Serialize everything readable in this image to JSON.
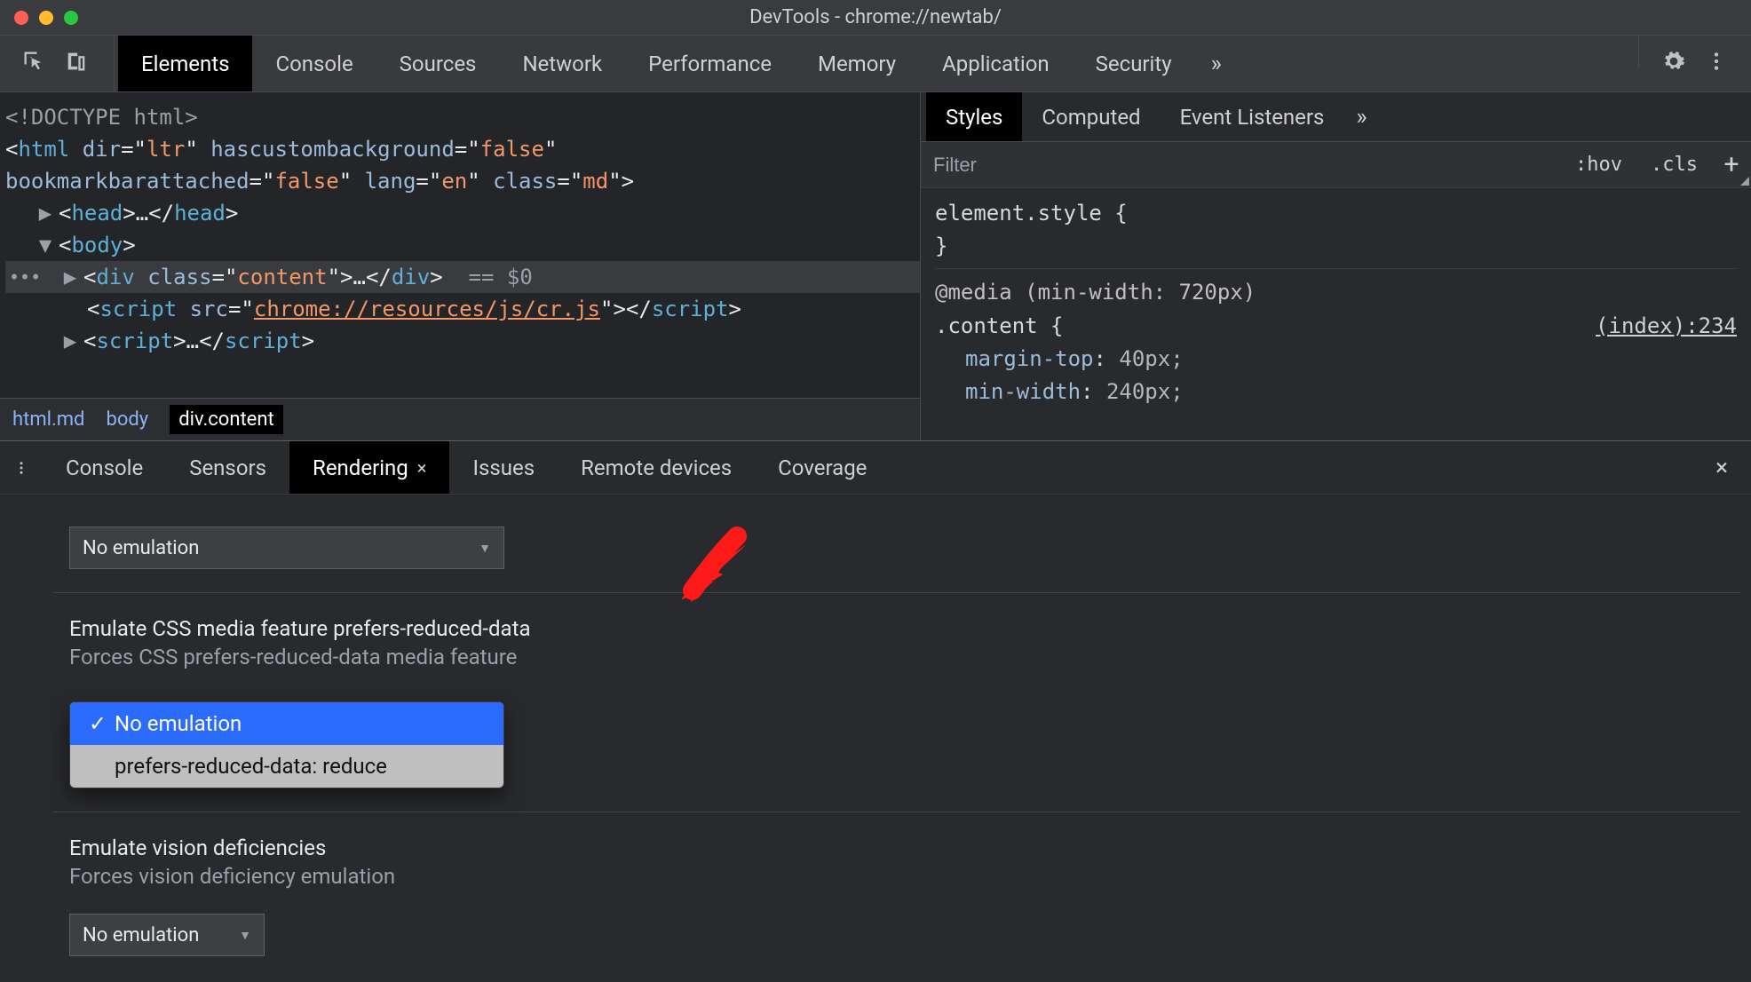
{
  "window": {
    "title": "DevTools - chrome://newtab/"
  },
  "mainTabs": {
    "items": [
      "Elements",
      "Console",
      "Sources",
      "Network",
      "Performance",
      "Memory",
      "Application",
      "Security"
    ],
    "activeIndex": 0,
    "moreGlyph": "»"
  },
  "dom": {
    "doctype": "<!DOCTYPE html>",
    "htmlOpen": {
      "tag": "html",
      "attrs": [
        {
          "n": "dir",
          "v": "ltr"
        },
        {
          "n": "hascustombackground",
          "v": "false"
        },
        {
          "n": "bookmarkbarattached",
          "v": "false"
        },
        {
          "n": "lang",
          "v": "en"
        },
        {
          "n": "class",
          "v": "md"
        }
      ]
    },
    "headCollapsed": "<head>…</head>",
    "bodyOpen": "<body>",
    "contentDiv": {
      "tag": "div",
      "attrClass": "content",
      "ellipsis": "…",
      "dollar": "== $0"
    },
    "scriptWithSrc": {
      "tag": "script",
      "srcLabel": "src",
      "srcVal": "chrome://resources/js/cr.js"
    },
    "scriptCollapsed": "<script>…</scr"
  },
  "breadcrumbs": {
    "items": [
      "html.md",
      "body",
      "div.content"
    ],
    "activeIndex": 2
  },
  "stylesPane": {
    "tabs": [
      "Styles",
      "Computed",
      "Event Listeners"
    ],
    "activeIndex": 0,
    "moreGlyph": "»",
    "filterPlaceholder": "Filter",
    "hovLabel": ":hov",
    "clsLabel": ".cls",
    "plusLabel": "+",
    "rules": {
      "elementStyleOpen": "element.style {",
      "elementStyleClose": "}",
      "mediaLine": "@media (min-width: 720px)",
      "selectorLine": ".content {",
      "sourceLink": "(index):234",
      "decls": [
        {
          "prop": "margin-top",
          "val": "40px;"
        },
        {
          "prop": "min-width",
          "val": "240px;"
        }
      ]
    }
  },
  "drawer": {
    "tabs": [
      "Console",
      "Sensors",
      "Rendering",
      "Issues",
      "Remote devices",
      "Coverage"
    ],
    "activeIndex": 2,
    "closeGlyph": "×"
  },
  "rendering": {
    "topSelectValue": "No emulation",
    "section1": {
      "title": "Emulate CSS media feature prefers-reduced-data",
      "desc": "Forces CSS prefers-reduced-data media feature"
    },
    "dropdown": {
      "options": [
        "No emulation",
        "prefers-reduced-data: reduce"
      ],
      "selectedIndex": 0
    },
    "section2": {
      "title": "Emulate vision deficiencies",
      "desc": "Forces vision deficiency emulation",
      "selectValue": "No emulation"
    }
  },
  "annotation": {
    "arrowColor": "#ff1a1a"
  }
}
